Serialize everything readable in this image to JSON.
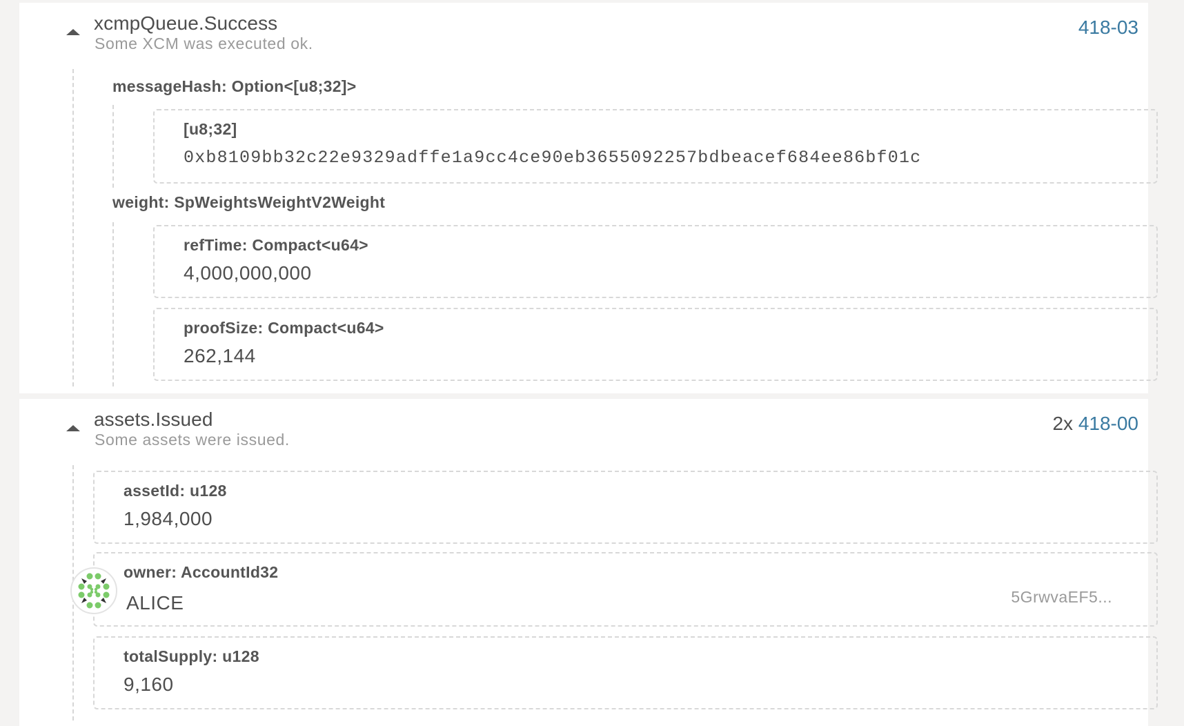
{
  "events": [
    {
      "title": "xcmpQueue.Success",
      "description": "Some XCM was executed ok.",
      "count": "",
      "link": "418-03",
      "params": {
        "messageHash": {
          "label": "messageHash: Option<[u8;32]>",
          "inner_label": "[u8;32]",
          "value": "0xb8109bb32c22e9329adffe1a9cc4ce90eb3655092257bdbeacef684ee86bf01c"
        },
        "weight": {
          "label": "weight: SpWeightsWeightV2Weight",
          "refTime": {
            "label": "refTime: Compact<u64>",
            "value": "4,000,000,000"
          },
          "proofSize": {
            "label": "proofSize: Compact<u64>",
            "value": "262,144"
          }
        }
      }
    },
    {
      "title": "assets.Issued",
      "description": "Some assets were issued.",
      "count": "2x",
      "link": "418-00",
      "params": {
        "assetId": {
          "label": "assetId: u128",
          "value": "1,984,000"
        },
        "owner": {
          "label": "owner: AccountId32",
          "value": "ALICE",
          "address": "5GrwvaEF5..."
        },
        "totalSupply": {
          "label": "totalSupply: u128",
          "value": "9,160"
        }
      }
    }
  ],
  "icons": {
    "collapse": "caret-up-icon",
    "identicon": "polkadot-identicon"
  },
  "colors": {
    "link": "#3a7aa1",
    "identicon_green": "#7ccb6a"
  }
}
